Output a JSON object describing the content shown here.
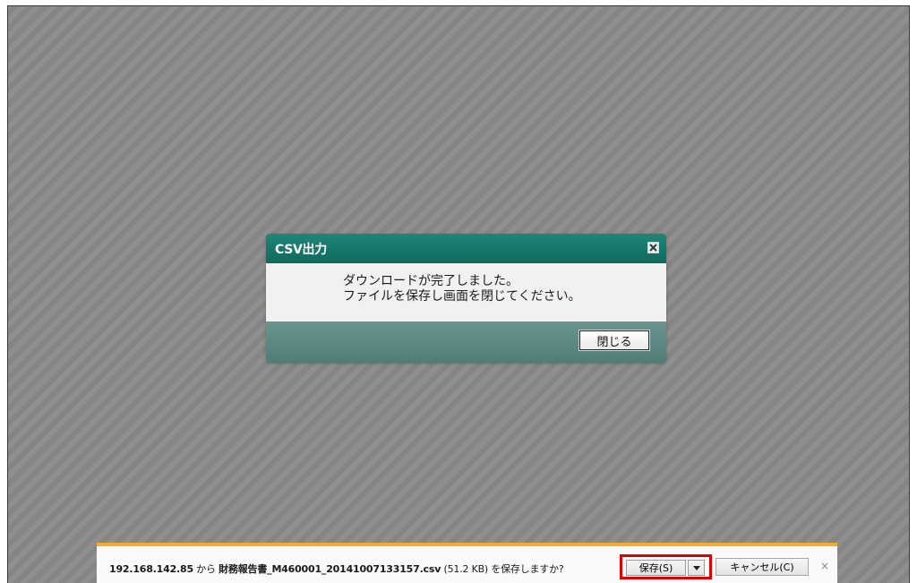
{
  "dialog": {
    "title": "CSV出力",
    "message_line1": "ダウンロードが完了しました。",
    "message_line2": "ファイルを保存し画面を閉じてください。",
    "close_button_label": "閉じる",
    "close_icon": "close-icon"
  },
  "download_bar": {
    "host": "192.168.142.85",
    "from_text": " から ",
    "filename": "財務報告書_M460001_20141007133157.csv",
    "size": " (51.2 KB) ",
    "question": "を保存しますか?",
    "save_label": "保存(S)",
    "dropdown_icon": "chevron-down-icon",
    "cancel_label": "キャンセル(C)",
    "close_glyph": "×"
  },
  "colors": {
    "dialog_header": "#137669",
    "dialog_footer": "#5b8a83",
    "bar_accent": "#f4ab2e",
    "highlight": "#e00000"
  }
}
